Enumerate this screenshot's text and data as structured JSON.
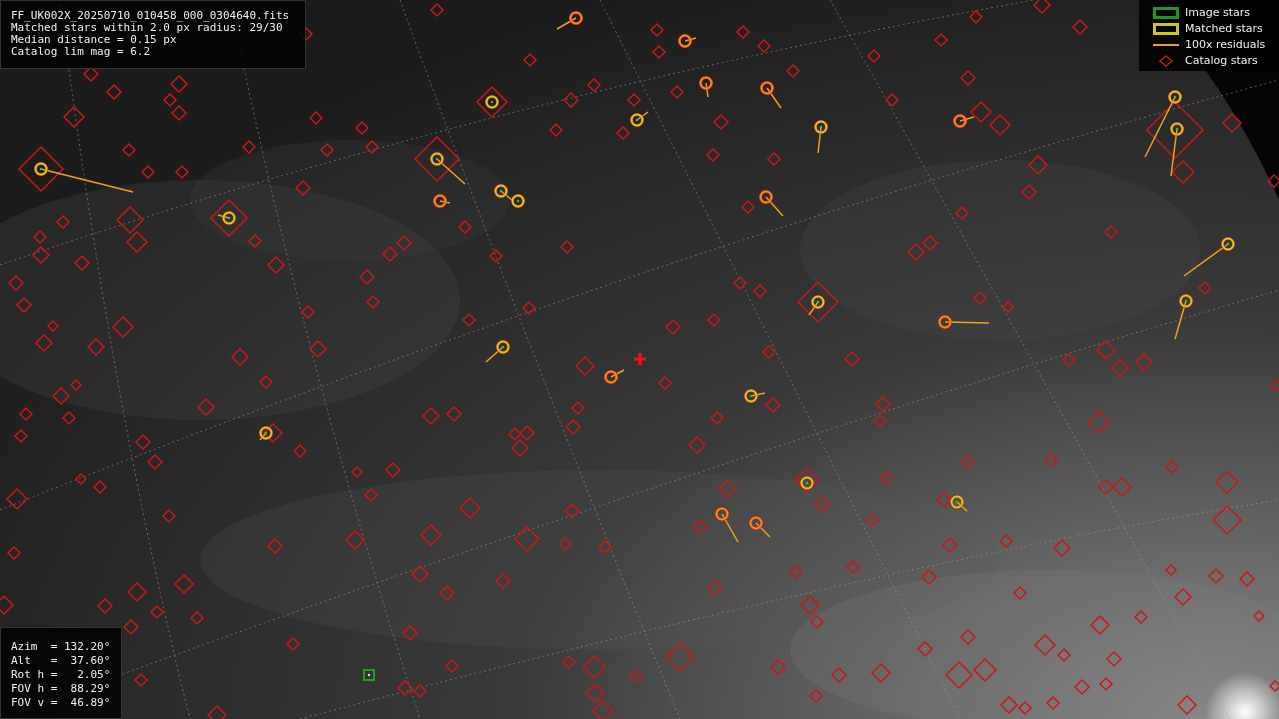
{
  "info_panel": {
    "lines": [
      "FF_UK002X_20250710_010458_000_0304640.fits",
      "Matched stars within 2.0 px radius: 29/30",
      "Median distance = 0.15 px",
      "Catalog lim mag = 6.2"
    ]
  },
  "legend": {
    "items": [
      {
        "kind": "box",
        "label": "Image stars",
        "color": "#1a9a1a"
      },
      {
        "kind": "box",
        "label": "Matched stars",
        "color": "#c8c81e"
      },
      {
        "kind": "line",
        "label": "100x residuals",
        "color": "#f0a020"
      },
      {
        "kind": "diamond",
        "label": "Catalog stars",
        "color": "#c01818"
      }
    ]
  },
  "pointing_panel": {
    "lines": [
      "Azim  = 132.20°",
      "Alt   =  37.60°",
      "Rot h =   2.05°",
      "FOV h =  88.29°",
      "FOV v =  46.89°"
    ]
  }
}
